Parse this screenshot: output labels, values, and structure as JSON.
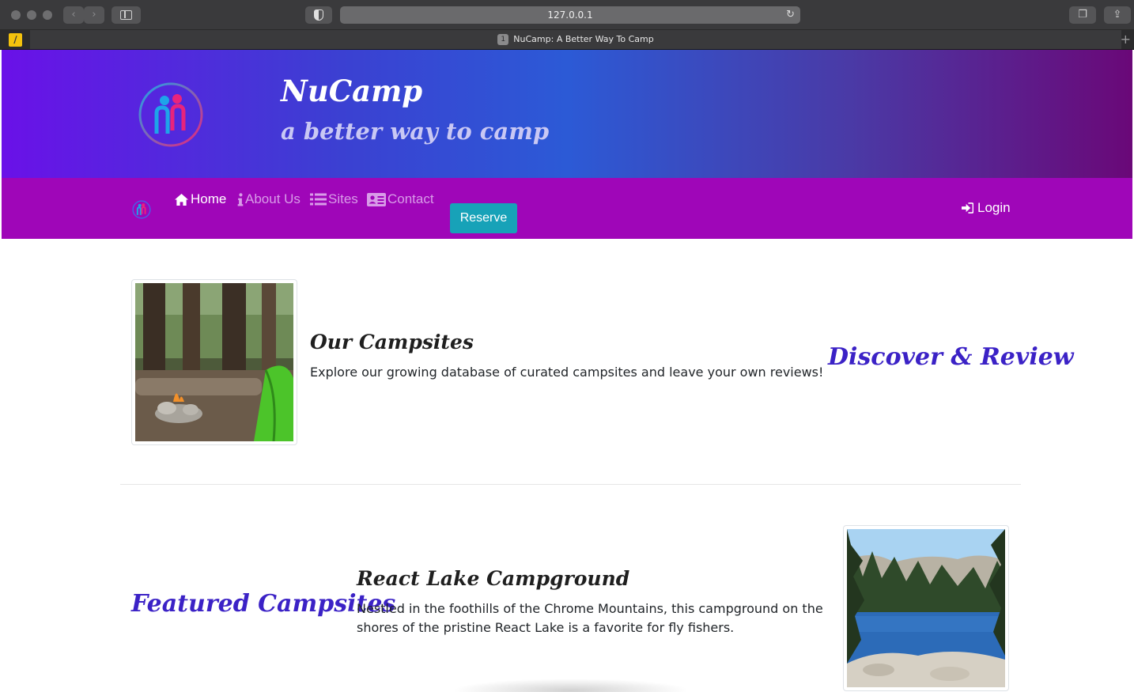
{
  "browser": {
    "url": "127.0.0.1",
    "tab": {
      "number": "1",
      "title": "NuCamp: A Better Way To Camp"
    }
  },
  "header": {
    "title": "NuCamp",
    "subtitle": "a better way to camp"
  },
  "nav": {
    "items": [
      {
        "label": "Home",
        "icon": "home-icon",
        "active": true
      },
      {
        "label": "About Us",
        "icon": "info-icon",
        "active": false
      },
      {
        "label": "Sites",
        "icon": "list-icon",
        "active": false
      },
      {
        "label": "Contact",
        "icon": "address-card-icon",
        "active": false
      }
    ],
    "reserve_label": "Reserve",
    "login_label": "Login"
  },
  "sections": {
    "campsites": {
      "title": "Our Campsites",
      "text": "Explore our growing database of curated campsites and leave your own reviews!",
      "accent": "Discover & Review"
    },
    "featured": {
      "accent": "Featured Campsites",
      "title": "React Lake Campground",
      "text_line1": "Nestled in the foothills of the Chrome Mountains, this campground on the",
      "text_line2": "shores of the pristine React Lake is a favorite for fly fishers."
    }
  },
  "colors": {
    "navbar": "#9f06b8",
    "reserve": "#17a2b8",
    "accent_heading": "#3b22c6"
  }
}
